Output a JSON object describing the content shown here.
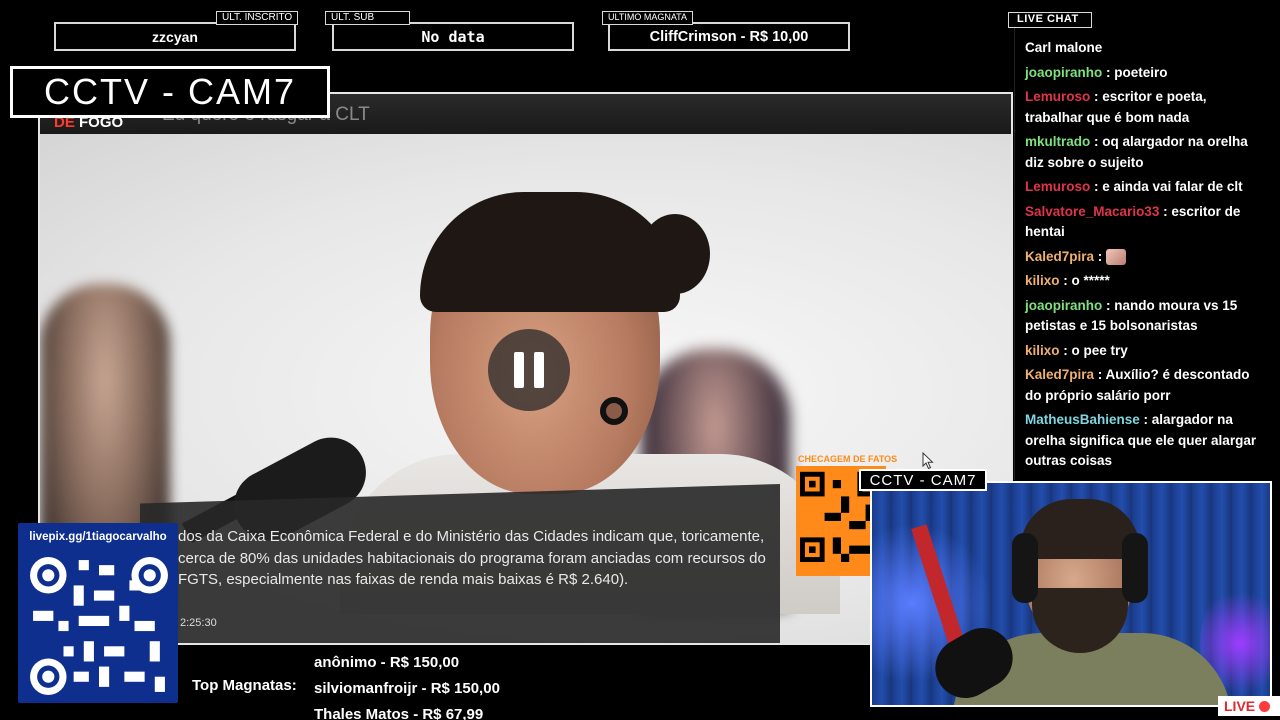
{
  "overlay": {
    "last_follower": {
      "tag": "ULT. INSCRITO",
      "value": "zzcyan"
    },
    "last_sub": {
      "tag": "ULT. SUB",
      "value": "No data"
    },
    "last_magnata": {
      "tag": "ULTIMO MAGNATA",
      "value": "CliffCrimson - R$ 10,00"
    },
    "cctv_label": "CCTV - CAM7",
    "cam_label": "CCTV - CAM7",
    "live_badge": "LIVE"
  },
  "video": {
    "brand_prefix": "DE",
    "brand_word": "FOGO",
    "headline": "Eu quero é rasgar a CLT",
    "caption": "dos da Caixa Econômica Federal e do Ministério das Cidades indicam que, toricamente, cerca de 80% das unidades habitacionais do programa foram anciadas com recursos do FGTS, especialmente nas faixas de renda mais baixas é R$ 2.640).",
    "timestamp": "2:25:30",
    "fact_check_label": "CHECAGEM DE FATOS",
    "state": "paused"
  },
  "chat": {
    "title": "LIVE CHAT",
    "messages": [
      {
        "user": "",
        "text": "Carl malone",
        "color": "#ffffff"
      },
      {
        "user": "joaopiranho",
        "text": "poeteiro",
        "color": "#7fe07f"
      },
      {
        "user": "Lemuroso",
        "text": "escritor e poeta, trabalhar que é bom nada",
        "color": "#e0344a"
      },
      {
        "user": "mkultrado",
        "text": "oq alargador na orelha diz sobre o sujeito",
        "color": "#7fe07f"
      },
      {
        "user": "Lemuroso",
        "text": "e ainda vai falar de clt",
        "color": "#e0344a"
      },
      {
        "user": "Salvatore_Macario33",
        "text": "escritor de hentai",
        "color": "#e0344a"
      },
      {
        "user": "Kaled7pira",
        "text": "",
        "color": "#f0b070",
        "emote": "face-emote"
      },
      {
        "user": "kilixo",
        "text": "o *****",
        "color": "#f0b070"
      },
      {
        "user": "joaopiranho",
        "text": "nando moura vs 15 petistas e 15 bolsonaristas",
        "color": "#7fe07f"
      },
      {
        "user": "kilixo",
        "text": "o pee try",
        "color": "#f0b070"
      },
      {
        "user": "Kaled7pira",
        "text": "Auxílio? é descontado do próprio salário porr",
        "color": "#f0b070"
      },
      {
        "user": "MatheusBahiense",
        "text": "alargador na orelha significa que ele quer alargar outras coisas",
        "color": "#7fd6e0"
      }
    ]
  },
  "livepix": {
    "url": "livepix.gg/1tiagocarvalho"
  },
  "magnatas": {
    "label": "Top Magnatas:",
    "items": [
      "anônimo - R$ 150,00",
      "silviomanfroijr - R$ 150,00",
      "Thales Matos - R$ 67,99"
    ]
  },
  "icons": {
    "pause": "pause-icon",
    "cursor": "cursor-icon",
    "qr": "qr-code-icon",
    "live_dot": "live-dot-icon"
  }
}
